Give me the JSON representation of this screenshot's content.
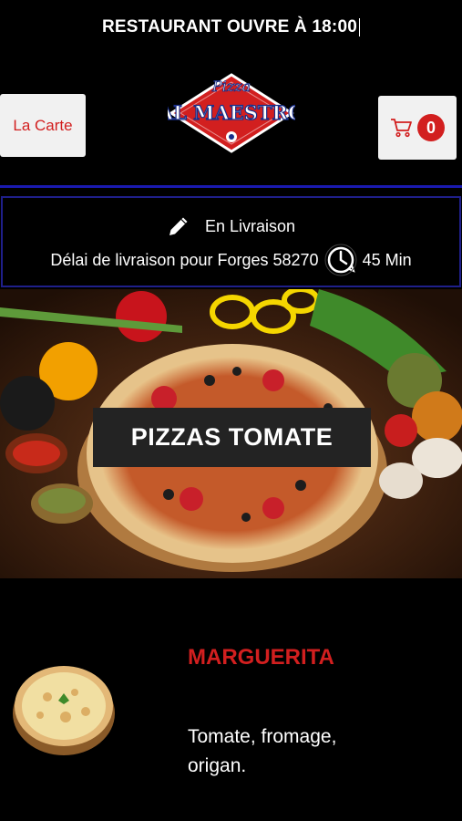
{
  "top_notice": {
    "text": "RESTAURANT OUVRE À 18:00"
  },
  "header": {
    "menu_button_label": "La Carte",
    "cart_count": "0",
    "logo": {
      "script_text": "Pizza",
      "brand_text": "AL MAESTRO"
    }
  },
  "delivery": {
    "mode_label": "En Livraison",
    "delay_label": "Délai de livraison pour Forges 58270",
    "delay_value": "45 Min"
  },
  "category": {
    "title": "PIZZAS TOMATE"
  },
  "products": [
    {
      "name": "MARGUERITA",
      "description": "Tomate, fromage, origan."
    }
  ],
  "colors": {
    "accent": "#d21f1f",
    "divider": "#1a1ab0",
    "background": "#000000"
  }
}
